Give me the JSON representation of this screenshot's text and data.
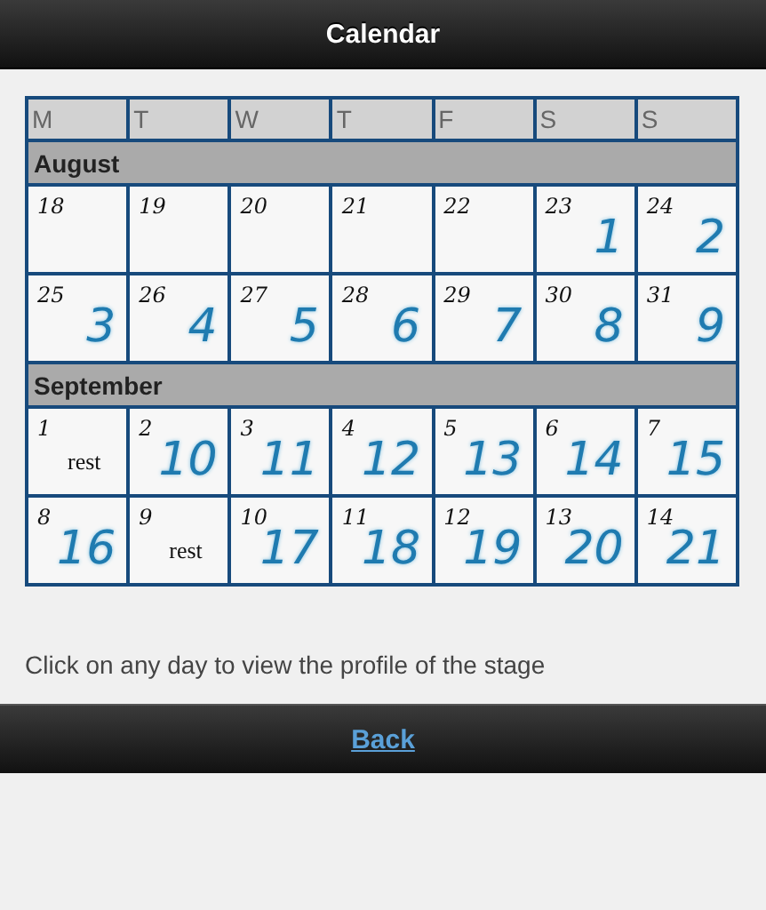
{
  "header": {
    "title": "Calendar"
  },
  "weekdays": [
    "M",
    "T",
    "W",
    "T",
    "F",
    "S",
    "S"
  ],
  "months": [
    {
      "name": "August",
      "weeks": [
        [
          {
            "kind": "plain",
            "day": "18"
          },
          {
            "kind": "plain",
            "day": "19"
          },
          {
            "kind": "plain",
            "day": "20"
          },
          {
            "kind": "plain",
            "day": "21"
          },
          {
            "kind": "plain",
            "day": "22"
          },
          {
            "kind": "stage",
            "day": "23",
            "stage": "1"
          },
          {
            "kind": "stage",
            "day": "24",
            "stage": "2"
          }
        ],
        [
          {
            "kind": "stage",
            "day": "25",
            "stage": "3"
          },
          {
            "kind": "stage",
            "day": "26",
            "stage": "4"
          },
          {
            "kind": "stage",
            "day": "27",
            "stage": "5"
          },
          {
            "kind": "stage",
            "day": "28",
            "stage": "6"
          },
          {
            "kind": "stage",
            "day": "29",
            "stage": "7"
          },
          {
            "kind": "stage",
            "day": "30",
            "stage": "8"
          },
          {
            "kind": "stage",
            "day": "31",
            "stage": "9"
          }
        ]
      ]
    },
    {
      "name": "September",
      "weeks": [
        [
          {
            "kind": "rest",
            "day": "1",
            "note": "rest"
          },
          {
            "kind": "stage",
            "day": "2",
            "stage": "10"
          },
          {
            "kind": "stage",
            "day": "3",
            "stage": "11"
          },
          {
            "kind": "stage",
            "day": "4",
            "stage": "12"
          },
          {
            "kind": "stage",
            "day": "5",
            "stage": "13"
          },
          {
            "kind": "stage",
            "day": "6",
            "stage": "14"
          },
          {
            "kind": "stage",
            "day": "7",
            "stage": "15"
          }
        ],
        [
          {
            "kind": "stage",
            "day": "8",
            "stage": "16"
          },
          {
            "kind": "rest",
            "day": "9",
            "note": "rest"
          },
          {
            "kind": "stage",
            "day": "10",
            "stage": "17"
          },
          {
            "kind": "stage",
            "day": "11",
            "stage": "18"
          },
          {
            "kind": "stage",
            "day": "12",
            "stage": "19"
          },
          {
            "kind": "stage",
            "day": "13",
            "stage": "20"
          },
          {
            "kind": "stage",
            "day": "14",
            "stage": "21"
          }
        ]
      ]
    }
  ],
  "hint": "Click on any day to view the profile of the stage",
  "footer": {
    "link": "Back"
  }
}
